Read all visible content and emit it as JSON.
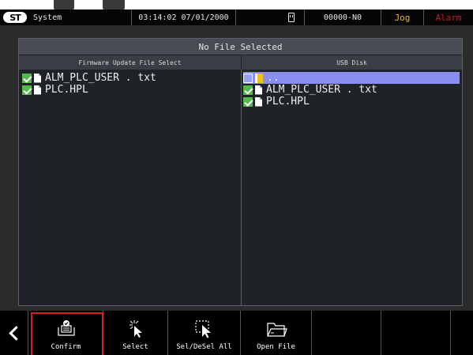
{
  "status_bar": {
    "section": "System",
    "datetime": "03:14:02 07/01/2000",
    "program": "00000-N0",
    "mode": "Jog",
    "alarm": "Alarm",
    "colors": {
      "mode": "#e0c020",
      "alarm": "#d01818"
    }
  },
  "panel": {
    "title": "No File Selected",
    "left_header": "Firmware Update File Select",
    "right_header": "USB Disk",
    "left_files": [
      {
        "name": "ALM_PLC_USER . txt",
        "checked": true,
        "icon": "file-icon"
      },
      {
        "name": "PLC.HPL",
        "checked": true,
        "icon": "file-icon"
      }
    ],
    "right_files": [
      {
        "name": "..",
        "checked": false,
        "icon": "folder-icon",
        "selected": true
      },
      {
        "name": "ALM_PLC_USER . txt",
        "checked": true,
        "icon": "file-icon"
      },
      {
        "name": "PLC.HPL",
        "checked": true,
        "icon": "file-icon"
      }
    ]
  },
  "toolbar": {
    "buttons": [
      {
        "label": "Confirm",
        "icon": "confirm-icon",
        "highlighted": true
      },
      {
        "label": "Select",
        "icon": "select-cursor-icon"
      },
      {
        "label": "Sel/DeSel All",
        "icon": "select-all-icon"
      },
      {
        "label": "Open File",
        "icon": "open-folder-icon"
      },
      {
        "label": "",
        "icon": ""
      },
      {
        "label": "",
        "icon": ""
      },
      {
        "label": "",
        "icon": ""
      }
    ],
    "highlight_color": "#d92020"
  }
}
